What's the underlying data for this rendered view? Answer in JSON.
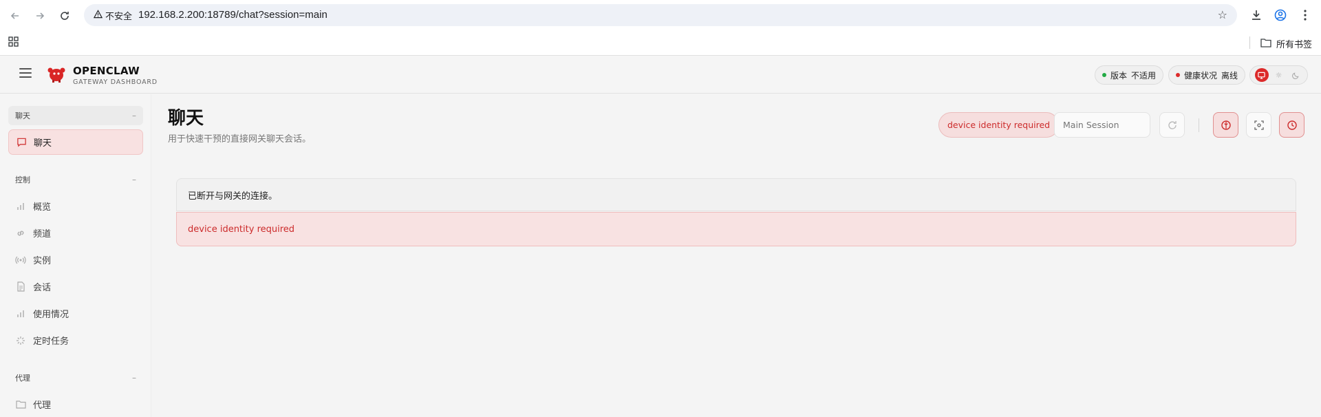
{
  "browser": {
    "security_label": "不安全",
    "url": "192.168.2.200:18789/chat?session=main",
    "bookmarks_folder": "所有书签"
  },
  "header": {
    "brand_title": "OPENCLAW",
    "brand_subtitle": "GATEWAY DASHBOARD",
    "version_label": "版本",
    "version_value": "不适用",
    "health_label": "健康状况",
    "health_value": "离线",
    "version_dot_color": "#22aa44",
    "health_dot_color": "#dc2a2a"
  },
  "sidebar": {
    "groups": [
      {
        "label": "聊天",
        "items": [
          {
            "label": "聊天",
            "icon": "message-icon",
            "active": true
          }
        ]
      },
      {
        "label": "控制",
        "items": [
          {
            "label": "概览",
            "icon": "bar-chart-icon"
          },
          {
            "label": "频道",
            "icon": "link-icon"
          },
          {
            "label": "实例",
            "icon": "radio-icon"
          },
          {
            "label": "会话",
            "icon": "document-icon"
          },
          {
            "label": "使用情况",
            "icon": "bar-chart-icon"
          },
          {
            "label": "定时任务",
            "icon": "loader-icon"
          }
        ]
      },
      {
        "label": "代理",
        "items": [
          {
            "label": "代理",
            "icon": "folder-icon"
          }
        ]
      }
    ]
  },
  "main": {
    "title": "聊天",
    "subtitle": "用于快速干预的直接网关聊天会话。",
    "error_chip": "device identity required",
    "session_placeholder": "Main Session",
    "notice": "已断开与网关的连接。",
    "error_message": "device identity required"
  },
  "colors": {
    "accent": "#dc2a2a",
    "error_text": "#cc2b2b"
  }
}
